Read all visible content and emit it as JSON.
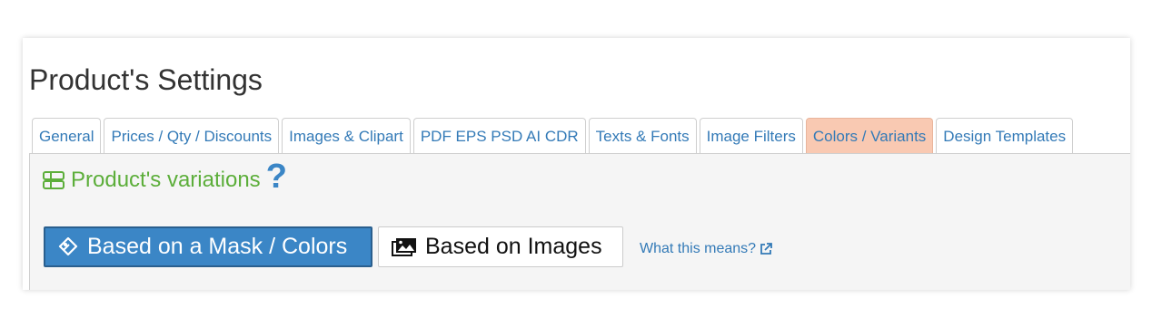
{
  "page": {
    "title": "Product's Settings"
  },
  "tabs": [
    {
      "label": "General",
      "active": false
    },
    {
      "label": "Prices / Qty / Discounts",
      "active": false
    },
    {
      "label": "Images & Clipart",
      "active": false
    },
    {
      "label": "PDF EPS PSD AI CDR",
      "active": false
    },
    {
      "label": "Texts & Fonts",
      "active": false
    },
    {
      "label": "Image Filters",
      "active": false
    },
    {
      "label": "Colors / Variants",
      "active": true
    },
    {
      "label": "Design Templates",
      "active": false
    }
  ],
  "section": {
    "title": "Product's variations",
    "icon": "variations-icon",
    "help_glyph": "?"
  },
  "buttons": {
    "mask": {
      "label": "Based on a Mask / Colors",
      "icon": "mask-icon",
      "selected": true
    },
    "images": {
      "label": "Based on Images",
      "icon": "images-icon",
      "selected": false
    }
  },
  "help_link": {
    "label": "What this means?",
    "icon": "external-link-icon"
  },
  "colors": {
    "accent": "#3b86c6",
    "active_tab": "#f9c9b2",
    "section_title": "#5cae3a",
    "link": "#337ab7"
  }
}
